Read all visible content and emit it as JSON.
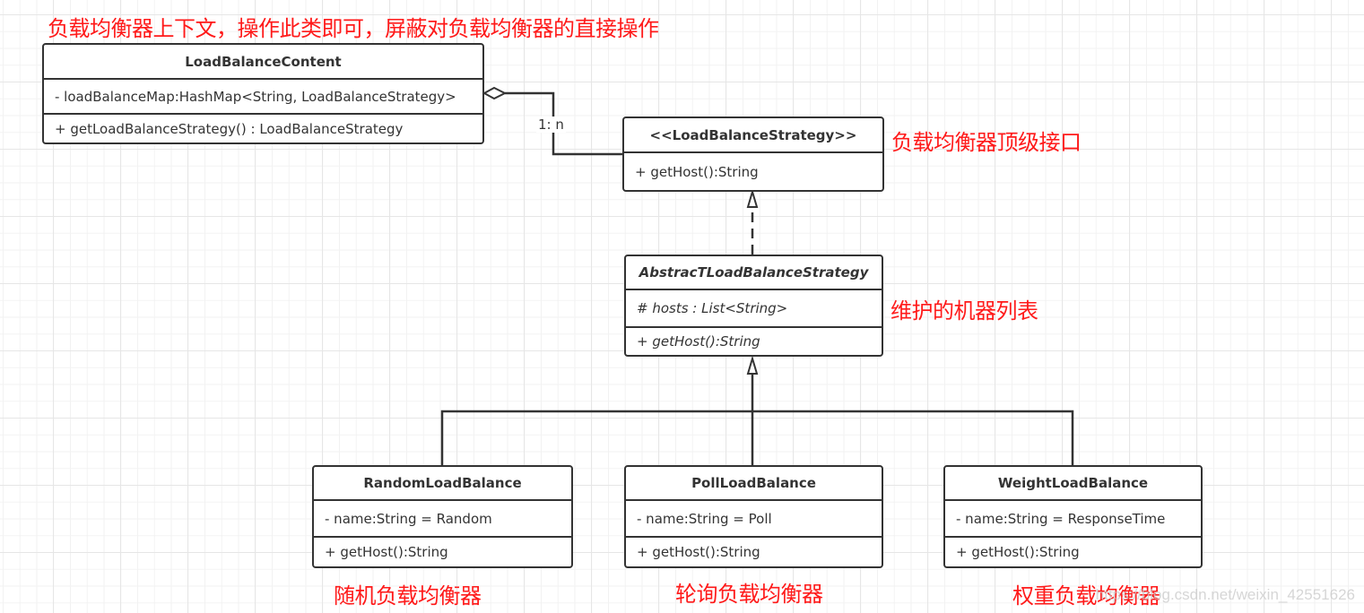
{
  "notes": {
    "context": "负载均衡器上下文，操作此类即可，屏蔽对负载均衡器的直接操作",
    "interface": "负载均衡器顶级接口",
    "abstract": "维护的机器列表",
    "random": "随机负载均衡器",
    "poll": "轮询负载均衡器",
    "weight": "权重负载均衡器"
  },
  "classes": {
    "context": {
      "name": "LoadBalanceContent",
      "attributes": [
        "- loadBalanceMap:HashMap<String, LoadBalanceStrategy>"
      ],
      "methods": [
        "+ getLoadBalanceStrategy() : LoadBalanceStrategy"
      ]
    },
    "strategy": {
      "name": "<<LoadBalanceStrategy>>",
      "methods": [
        "+ getHost():String"
      ]
    },
    "abstract": {
      "name": "AbstracTLoadBalanceStrategy",
      "attributes": [
        "# hosts : List<String>"
      ],
      "methods": [
        "+ getHost():String"
      ]
    },
    "random": {
      "name": "RandomLoadBalance",
      "attributes": [
        "- name:String = Random"
      ],
      "methods": [
        "+ getHost():String"
      ]
    },
    "poll": {
      "name": "PollLoadBalance",
      "attributes": [
        "- name:String = Poll"
      ],
      "methods": [
        "+ getHost():String"
      ]
    },
    "weight": {
      "name": "WeightLoadBalance",
      "attributes": [
        "- name:String = ResponseTime"
      ],
      "methods": [
        "+ getHost():String"
      ]
    }
  },
  "relations": {
    "aggregation_multiplicity": "1:  n"
  },
  "watermark": "https://blog.csdn.net/weixin_42551626",
  "colors": {
    "line": "#333333",
    "note": "#ff1a1a"
  }
}
